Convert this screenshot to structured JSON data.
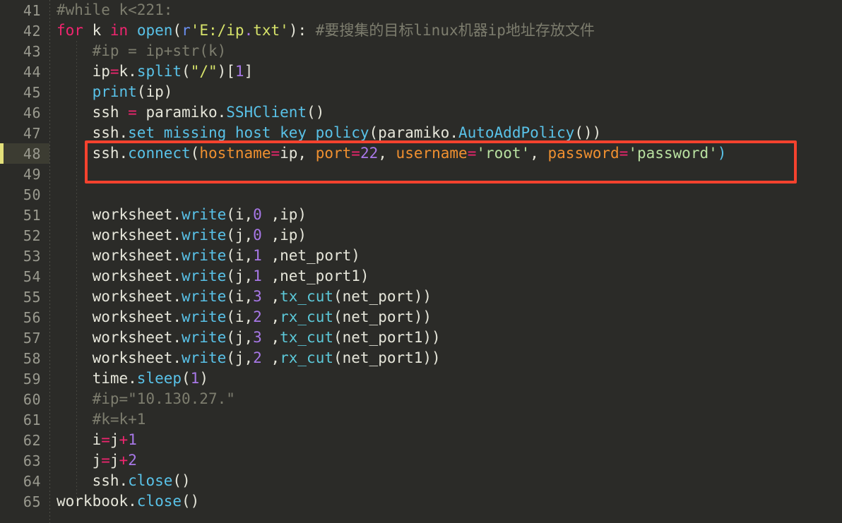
{
  "editor": {
    "title": "python-code-editor",
    "language": "Python",
    "theme_background": "#2b2b28",
    "first_line_number": 41,
    "last_line_number": 65,
    "highlighted_line": 48,
    "annotation": {
      "type": "rectangle",
      "color": "#f4422e",
      "targets_line": 48,
      "label": "red-highlight-box"
    },
    "colors": {
      "background": "#2b2b28",
      "gutter_text": "#9a9a8f",
      "line_highlight": "#3c3c32",
      "marker": "#e3e07a",
      "comment": "#7d7d6e",
      "keyword": "#f0256f",
      "function": "#59c2e8",
      "number": "#a878e8",
      "string": "#d7e36a",
      "parameter": "#f09030",
      "plain": "#e6e6da",
      "annotation_red": "#f4422e"
    }
  },
  "lines": [
    {
      "number": 41,
      "text": "#while k<221:",
      "tokens": [
        {
          "c": "t-indent",
          "v": ""
        },
        {
          "c": "t-comment",
          "v": "#while k<221:"
        }
      ]
    },
    {
      "number": 42,
      "text": "for k in open(r'E:/ip.txt'): #要搜集的目标linux机器ip地址存放文件",
      "tokens": [
        {
          "c": "t-keyword",
          "v": "for"
        },
        {
          "c": "t-plain",
          "v": " k "
        },
        {
          "c": "t-keyword",
          "v": "in"
        },
        {
          "c": "t-plain",
          "v": " "
        },
        {
          "c": "t-func",
          "v": "open"
        },
        {
          "c": "t-punct",
          "v": "("
        },
        {
          "c": "t-prefix",
          "v": "r"
        },
        {
          "c": "t-string",
          "v": "'E:/ip"
        },
        {
          "c": "t-dot",
          "v": "."
        },
        {
          "c": "t-string",
          "v": "txt'"
        },
        {
          "c": "t-punct",
          "v": "): "
        },
        {
          "c": "t-comment",
          "v": "#要搜集的目标linux机器ip地址存放文件"
        }
      ]
    },
    {
      "number": 43,
      "text": "    #ip = ip+str(k)",
      "tokens": [
        {
          "c": "t-plain",
          "v": "    "
        },
        {
          "c": "t-comment",
          "v": "#ip = ip+str(k)"
        }
      ]
    },
    {
      "number": 44,
      "text": "    ip=k.split(\"/\")[1]",
      "tokens": [
        {
          "c": "t-plain",
          "v": "    ip"
        },
        {
          "c": "t-op",
          "v": "="
        },
        {
          "c": "t-plain",
          "v": "k."
        },
        {
          "c": "t-func",
          "v": "split"
        },
        {
          "c": "t-punct",
          "v": "("
        },
        {
          "c": "t-string",
          "v": "\"/\""
        },
        {
          "c": "t-punct",
          "v": ")["
        },
        {
          "c": "t-number",
          "v": "1"
        },
        {
          "c": "t-punct",
          "v": "]"
        }
      ]
    },
    {
      "number": 45,
      "text": "    print(ip)",
      "tokens": [
        {
          "c": "t-plain",
          "v": "    "
        },
        {
          "c": "t-func",
          "v": "print"
        },
        {
          "c": "t-punct",
          "v": "(ip)"
        }
      ]
    },
    {
      "number": 46,
      "text": "    ssh = paramiko.SSHClient()",
      "tokens": [
        {
          "c": "t-plain",
          "v": "    ssh "
        },
        {
          "c": "t-op",
          "v": "="
        },
        {
          "c": "t-plain",
          "v": " paramiko."
        },
        {
          "c": "t-func",
          "v": "SSHClient"
        },
        {
          "c": "t-punct",
          "v": "()"
        }
      ]
    },
    {
      "number": 47,
      "text": "    ssh.set_missing_host_key_policy(paramiko.AutoAddPolicy())",
      "tokens": [
        {
          "c": "t-plain",
          "v": "    ssh."
        },
        {
          "c": "t-func",
          "v": "set_missing_host_key_policy"
        },
        {
          "c": "t-punct",
          "v": "(paramiko."
        },
        {
          "c": "t-func",
          "v": "AutoAddPolicy"
        },
        {
          "c": "t-punct",
          "v": "())"
        }
      ]
    },
    {
      "number": 48,
      "text": "    ssh.connect(hostname=ip, port=22, username='root', password='password')",
      "highlighted": true,
      "tokens": [
        {
          "c": "t-plain",
          "v": "    ssh."
        },
        {
          "c": "t-func",
          "v": "connect"
        },
        {
          "c": "t-punct",
          "v": "("
        },
        {
          "c": "t-param",
          "v": "hostname"
        },
        {
          "c": "t-op",
          "v": "="
        },
        {
          "c": "t-plain",
          "v": "ip, "
        },
        {
          "c": "t-param",
          "v": "port"
        },
        {
          "c": "t-op",
          "v": "="
        },
        {
          "c": "t-number",
          "v": "22"
        },
        {
          "c": "t-plain",
          "v": ", "
        },
        {
          "c": "t-param",
          "v": "username"
        },
        {
          "c": "t-op",
          "v": "="
        },
        {
          "c": "t-string2",
          "v": "'root'"
        },
        {
          "c": "t-plain",
          "v": ", "
        },
        {
          "c": "t-param",
          "v": "password"
        },
        {
          "c": "t-op",
          "v": "="
        },
        {
          "c": "t-string2",
          "v": "'password'"
        },
        {
          "c": "t-func",
          "v": ")"
        }
      ]
    },
    {
      "number": 49,
      "text": "",
      "tokens": []
    },
    {
      "number": 50,
      "text": "",
      "tokens": []
    },
    {
      "number": 51,
      "text": "    worksheet.write(i,0 ,ip)",
      "tokens": [
        {
          "c": "t-plain",
          "v": "    worksheet."
        },
        {
          "c": "t-func",
          "v": "write"
        },
        {
          "c": "t-punct",
          "v": "(i,"
        },
        {
          "c": "t-number",
          "v": "0"
        },
        {
          "c": "t-punct",
          "v": " ,ip)"
        }
      ]
    },
    {
      "number": 52,
      "text": "    worksheet.write(j,0 ,ip)",
      "tokens": [
        {
          "c": "t-plain",
          "v": "    worksheet."
        },
        {
          "c": "t-func",
          "v": "write"
        },
        {
          "c": "t-punct",
          "v": "(j,"
        },
        {
          "c": "t-number",
          "v": "0"
        },
        {
          "c": "t-punct",
          "v": " ,ip)"
        }
      ]
    },
    {
      "number": 53,
      "text": "    worksheet.write(i,1 ,net_port)",
      "tokens": [
        {
          "c": "t-plain",
          "v": "    worksheet."
        },
        {
          "c": "t-func",
          "v": "write"
        },
        {
          "c": "t-punct",
          "v": "(i,"
        },
        {
          "c": "t-number",
          "v": "1"
        },
        {
          "c": "t-punct",
          "v": " ,net_port)"
        }
      ]
    },
    {
      "number": 54,
      "text": "    worksheet.write(j,1 ,net_port1)",
      "tokens": [
        {
          "c": "t-plain",
          "v": "    worksheet."
        },
        {
          "c": "t-func",
          "v": "write"
        },
        {
          "c": "t-punct",
          "v": "(j,"
        },
        {
          "c": "t-number",
          "v": "1"
        },
        {
          "c": "t-punct",
          "v": " ,net_port1)"
        }
      ]
    },
    {
      "number": 55,
      "text": "    worksheet.write(i,3 ,tx_cut(net_port))",
      "tokens": [
        {
          "c": "t-plain",
          "v": "    worksheet."
        },
        {
          "c": "t-func",
          "v": "write"
        },
        {
          "c": "t-punct",
          "v": "(i,"
        },
        {
          "c": "t-number",
          "v": "3"
        },
        {
          "c": "t-punct",
          "v": " ,"
        },
        {
          "c": "t-func2",
          "v": "tx_cut"
        },
        {
          "c": "t-punct",
          "v": "(net_port))"
        }
      ]
    },
    {
      "number": 56,
      "text": "    worksheet.write(i,2 ,rx_cut(net_port))",
      "tokens": [
        {
          "c": "t-plain",
          "v": "    worksheet."
        },
        {
          "c": "t-func",
          "v": "write"
        },
        {
          "c": "t-punct",
          "v": "(i,"
        },
        {
          "c": "t-number",
          "v": "2"
        },
        {
          "c": "t-punct",
          "v": " ,"
        },
        {
          "c": "t-func2",
          "v": "rx_cut"
        },
        {
          "c": "t-punct",
          "v": "(net_port))"
        }
      ]
    },
    {
      "number": 57,
      "text": "    worksheet.write(j,3 ,tx_cut(net_port1))",
      "tokens": [
        {
          "c": "t-plain",
          "v": "    worksheet."
        },
        {
          "c": "t-func",
          "v": "write"
        },
        {
          "c": "t-punct",
          "v": "(j,"
        },
        {
          "c": "t-number",
          "v": "3"
        },
        {
          "c": "t-punct",
          "v": " ,"
        },
        {
          "c": "t-func2",
          "v": "tx_cut"
        },
        {
          "c": "t-punct",
          "v": "(net_port1))"
        }
      ]
    },
    {
      "number": 58,
      "text": "    worksheet.write(j,2 ,rx_cut(net_port1))",
      "tokens": [
        {
          "c": "t-plain",
          "v": "    worksheet."
        },
        {
          "c": "t-func",
          "v": "write"
        },
        {
          "c": "t-punct",
          "v": "(j,"
        },
        {
          "c": "t-number",
          "v": "2"
        },
        {
          "c": "t-punct",
          "v": " ,"
        },
        {
          "c": "t-func2",
          "v": "rx_cut"
        },
        {
          "c": "t-punct",
          "v": "(net_port1))"
        }
      ]
    },
    {
      "number": 59,
      "text": "    time.sleep(1)",
      "tokens": [
        {
          "c": "t-plain",
          "v": "    time."
        },
        {
          "c": "t-func",
          "v": "sleep"
        },
        {
          "c": "t-punct",
          "v": "("
        },
        {
          "c": "t-number",
          "v": "1"
        },
        {
          "c": "t-punct",
          "v": ")"
        }
      ]
    },
    {
      "number": 60,
      "text": "    #ip=\"10.130.27.\"",
      "tokens": [
        {
          "c": "t-plain",
          "v": "    "
        },
        {
          "c": "t-comment",
          "v": "#ip=\"10.130.27.\""
        }
      ]
    },
    {
      "number": 61,
      "text": "    #k=k+1",
      "tokens": [
        {
          "c": "t-plain",
          "v": "    "
        },
        {
          "c": "t-comment",
          "v": "#k=k+1"
        }
      ]
    },
    {
      "number": 62,
      "text": "    i=j+1",
      "tokens": [
        {
          "c": "t-plain",
          "v": "    i"
        },
        {
          "c": "t-op",
          "v": "="
        },
        {
          "c": "t-plain",
          "v": "j"
        },
        {
          "c": "t-op",
          "v": "+"
        },
        {
          "c": "t-number",
          "v": "1"
        }
      ]
    },
    {
      "number": 63,
      "text": "    j=j+2",
      "tokens": [
        {
          "c": "t-plain",
          "v": "    j"
        },
        {
          "c": "t-op",
          "v": "="
        },
        {
          "c": "t-plain",
          "v": "j"
        },
        {
          "c": "t-op",
          "v": "+"
        },
        {
          "c": "t-number",
          "v": "2"
        }
      ]
    },
    {
      "number": 64,
      "text": "    ssh.close()",
      "tokens": [
        {
          "c": "t-plain",
          "v": "    ssh."
        },
        {
          "c": "t-func",
          "v": "close"
        },
        {
          "c": "t-punct",
          "v": "()"
        }
      ]
    },
    {
      "number": 65,
      "text": "workbook.close()",
      "tokens": [
        {
          "c": "t-plain",
          "v": "workbook."
        },
        {
          "c": "t-func",
          "v": "close"
        },
        {
          "c": "t-punct",
          "v": "()"
        }
      ]
    }
  ]
}
